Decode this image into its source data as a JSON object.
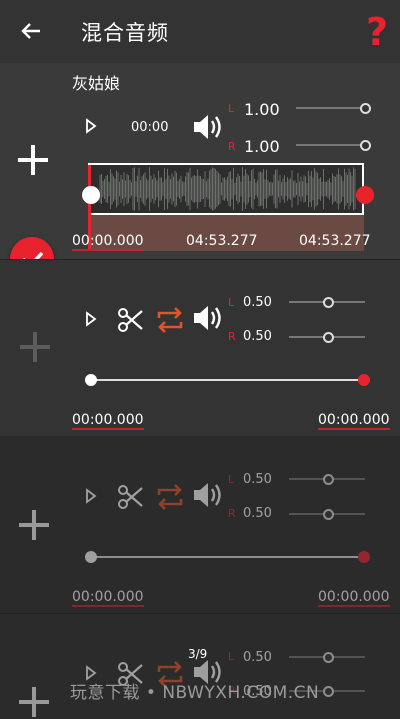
{
  "header": {
    "title": "混合音频"
  },
  "tracks": [
    {
      "name": "灰姑娘",
      "play_time": "00:00",
      "left_label": "L",
      "left_value": "1.00",
      "right_label": "R",
      "right_value": "1.00",
      "left_level": 1.0,
      "right_level": 1.0,
      "start": "00:00.000",
      "mid": "04:53.277",
      "end": "04:53.277"
    },
    {
      "left_label": "L",
      "left_value": "0.50",
      "right_label": "R",
      "right_value": "0.50",
      "left_level": 0.5,
      "right_level": 0.5,
      "start": "00:00.000",
      "end": "00:00.000"
    },
    {
      "left_label": "L",
      "left_value": "0.50",
      "right_label": "R",
      "right_value": "0.50",
      "left_level": 0.5,
      "right_level": 0.5,
      "start": "00:00.000",
      "end": "00:00.000"
    },
    {
      "left_label": "L",
      "left_value": "0.50",
      "right_label": "R",
      "right_value": "0.50",
      "left_level": 0.5,
      "right_level": 0.5
    }
  ],
  "pager": "3/9",
  "watermark": "玩意下载 • NBWYXH.COM.CN",
  "colors": {
    "accent_red": "#e8232e",
    "loop_orange": "#e0552a"
  }
}
